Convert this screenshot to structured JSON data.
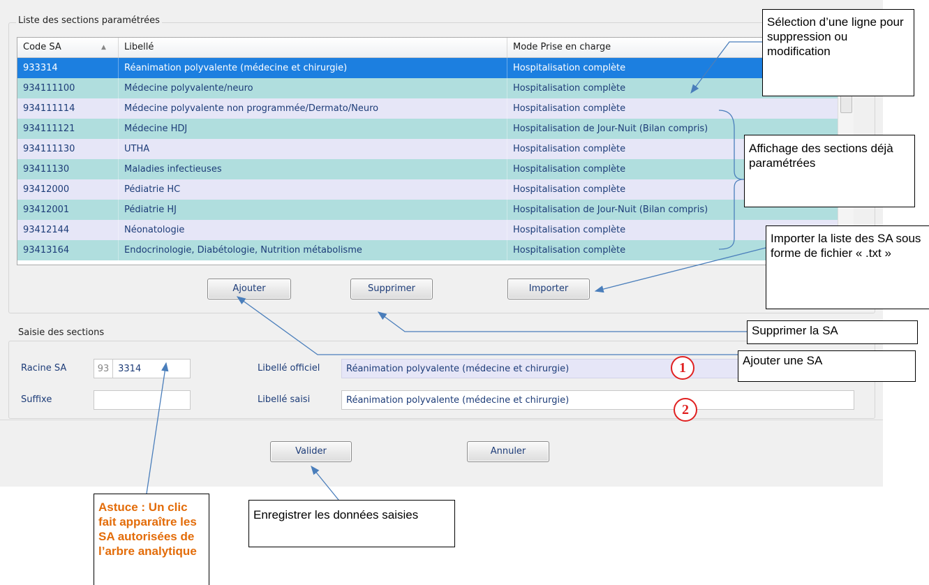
{
  "sections_list": {
    "legend": "Liste des sections paramétrées",
    "columns": [
      "Code SA",
      "Libellé",
      "Mode Prise en charge"
    ],
    "sort_indicator": "▲",
    "rows": [
      {
        "code": "933314",
        "libelle": "Réanimation polyvalente (médecine et chirurgie)",
        "mode": "Hospitalisation complète",
        "selected": true
      },
      {
        "code": "934111100",
        "libelle": "Médecine polyvalente/neuro",
        "mode": "Hospitalisation complète"
      },
      {
        "code": "934111114",
        "libelle": "Médecine polyvalente non programmée/Dermato/Neuro",
        "mode": "Hospitalisation complète"
      },
      {
        "code": "934111121",
        "libelle": "Médecine HDJ",
        "mode": "Hospitalisation de Jour-Nuit (Bilan compris)"
      },
      {
        "code": "934111130",
        "libelle": "UTHA",
        "mode": "Hospitalisation complète"
      },
      {
        "code": "93411130",
        "libelle": "Maladies infectieuses",
        "mode": "Hospitalisation complète"
      },
      {
        "code": "93412000",
        "libelle": "Pédiatrie HC",
        "mode": "Hospitalisation complète"
      },
      {
        "code": "93412001",
        "libelle": "Pédiatrie HJ",
        "mode": "Hospitalisation de Jour-Nuit (Bilan compris)"
      },
      {
        "code": "93412144",
        "libelle": "Néonatologie",
        "mode": "Hospitalisation complète"
      },
      {
        "code": "93413164",
        "libelle": "Endocrinologie, Diabétologie, Nutrition métabolisme",
        "mode": "Hospitalisation complète"
      }
    ],
    "buttons": {
      "add": "Ajouter",
      "delete": "Supprimer",
      "import": "Importer"
    }
  },
  "entry": {
    "legend": "Saisie des sections",
    "racine_label": "Racine SA",
    "racine_prefix": "93",
    "racine_value": "3314",
    "suffix_label": "Suffixe",
    "suffix_value": "",
    "libelle_officiel_label": "Libellé officiel",
    "libelle_officiel_value": "Réanimation polyvalente (médecine et chirurgie)",
    "libelle_saisi_label": "Libellé saisi",
    "libelle_saisi_value": "Réanimation polyvalente (médecine et chirurgie)",
    "validate": "Valider",
    "cancel": "Annuler"
  },
  "annotations": {
    "select": "Sélection d’une ligne pour suppression ou modification",
    "display": "Affichage des sections déjà paramétrées",
    "import": "Importer la liste des SA sous forme de fichier « .txt »",
    "delete": "Supprimer la SA",
    "add": "Ajouter une SA",
    "save": "Enregistrer les données saisies",
    "tip": "Astuce : Un clic fait apparaître les SA autorisées de l’arbre analytique",
    "marker_1": "1",
    "marker_2": "2"
  },
  "colors": {
    "selected_row": "#1c7fe0",
    "row_teal": "#b0dede",
    "row_lavender": "#e6e6f7",
    "tip_orange": "#e36c09",
    "marker_red": "#e02020",
    "arrow_blue": "#4a7ebb"
  }
}
